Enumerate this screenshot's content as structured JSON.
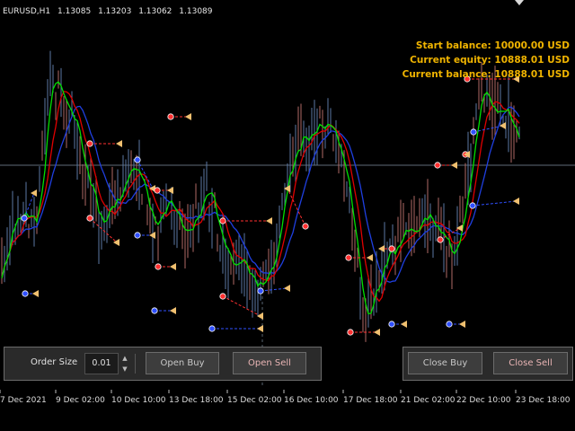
{
  "symbol": {
    "name": "EURUSD,H1",
    "open": "1.13085",
    "high": "1.13203",
    "low": "1.13062",
    "close": "1.13089"
  },
  "stats": {
    "start_balance": "Start balance: 10000.00 USD",
    "current_equity": "Current equity: 10888.01  USD",
    "current_balance": "Current balance: 10888.01  USD"
  },
  "trade_panel": {
    "order_size_label": "Order Size",
    "order_size_value": "0.01",
    "open_buy": "Open Buy",
    "open_sell": "Open Sell",
    "close_buy": "Close Buy",
    "close_sell": "Close Sell"
  },
  "x_axis": [
    "7 Dec 2021",
    "9 Dec 02:00",
    "10 Dec 10:00",
    "13 Dec 18:00",
    "15 Dec 02:00",
    "16 Dec 10:00",
    "17 Dec 18:00",
    "21 Dec 02:00",
    "22 Dec 10:00",
    "23 Dec 18:00"
  ],
  "colors": {
    "background": "#000000",
    "bull_candle": "#5b79a3",
    "bear_candle": "#b06a66",
    "ma_fast": "#00e000",
    "ma_mid": "#e00000",
    "ma_slow": "#1f3fe0",
    "stats_text": "#f0b400",
    "buy_marker": "#2f4fff",
    "sell_marker": "#ff3030",
    "close_marker": "#f0c070"
  },
  "icons": {
    "spin_up": "▲",
    "spin_down": "▼"
  }
}
